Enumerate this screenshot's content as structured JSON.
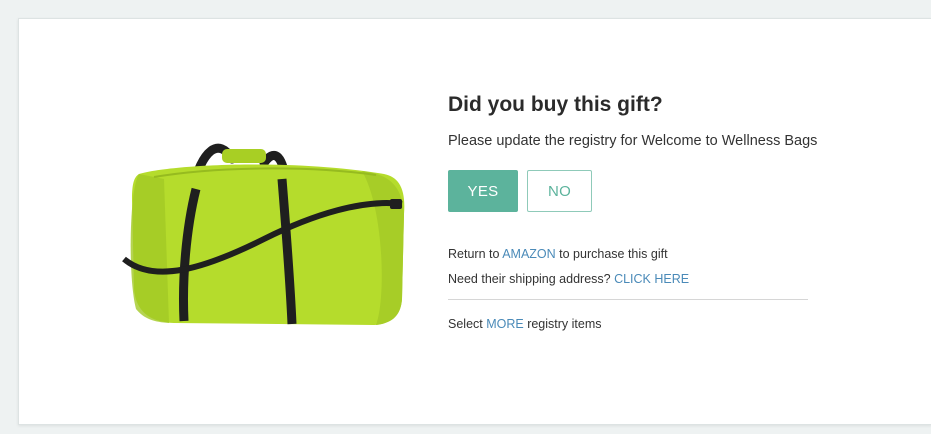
{
  "dialog": {
    "title": "Did you buy this gift?",
    "subtitle": "Please update the registry for Welcome to Wellness Bags",
    "yes_label": "YES",
    "no_label": "NO",
    "return_prefix": "Return to ",
    "return_link": "AMAZON",
    "return_suffix": " to purchase this gift",
    "shipping_prefix": "Need their shipping address? ",
    "shipping_link": "CLICK HERE",
    "more_prefix": "Select ",
    "more_link": "MORE",
    "more_suffix": " registry items"
  },
  "product": {
    "image_icon": "duffel-bag-image",
    "bag_color": "#b5dc2c",
    "strap_color": "#1f1f1f"
  },
  "colors": {
    "accent": "#5cb39c",
    "link": "#4a8ab8"
  }
}
